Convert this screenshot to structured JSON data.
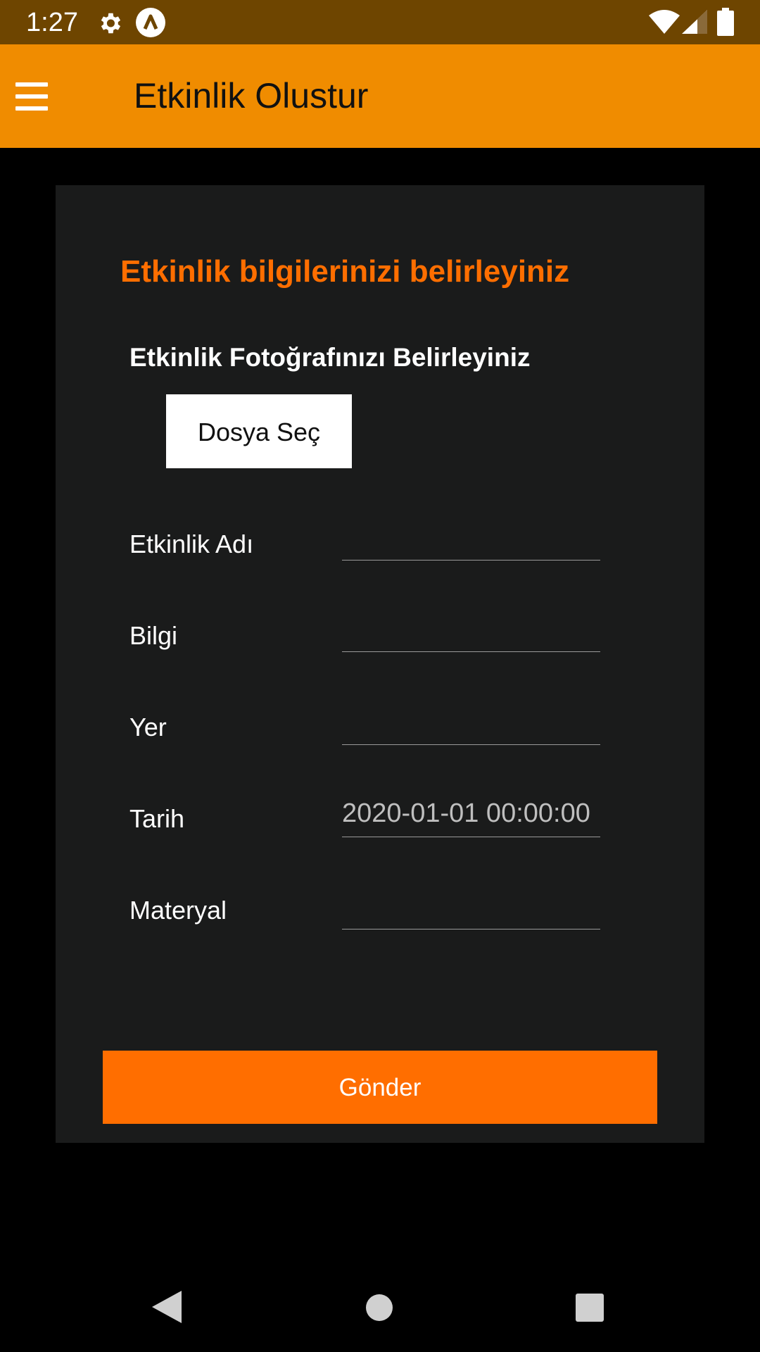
{
  "status_bar": {
    "time": "1:27",
    "icons": [
      "gear-icon",
      "app-logo-icon",
      "wifi-icon",
      "signal-icon",
      "battery-icon"
    ]
  },
  "app_bar": {
    "title": "Etkinlik Olustur",
    "menu_icon": "hamburger-menu-icon"
  },
  "form": {
    "heading": "Etkinlik bilgilerinizi belirleyiniz",
    "photo_label": "Etkinlik Fotoğrafınızı Belirleyiniz",
    "file_button_label": "Dosya Seç",
    "fields": [
      {
        "label": "Etkinlik Adı",
        "value": ""
      },
      {
        "label": "Bilgi",
        "value": ""
      },
      {
        "label": "Yer",
        "value": ""
      },
      {
        "label": "Tarih",
        "value": "2020-01-01 00:00:00"
      },
      {
        "label": "Materyal",
        "value": ""
      }
    ],
    "submit_label": "Gönder"
  },
  "colors": {
    "status_bar": "#6e4500",
    "app_bar": "#f08c00",
    "accent": "#ff6e00",
    "card": "#1a1b1b",
    "background": "#000000"
  },
  "nav_bar": {
    "icons": [
      "back-icon",
      "home-icon",
      "recents-icon"
    ]
  }
}
